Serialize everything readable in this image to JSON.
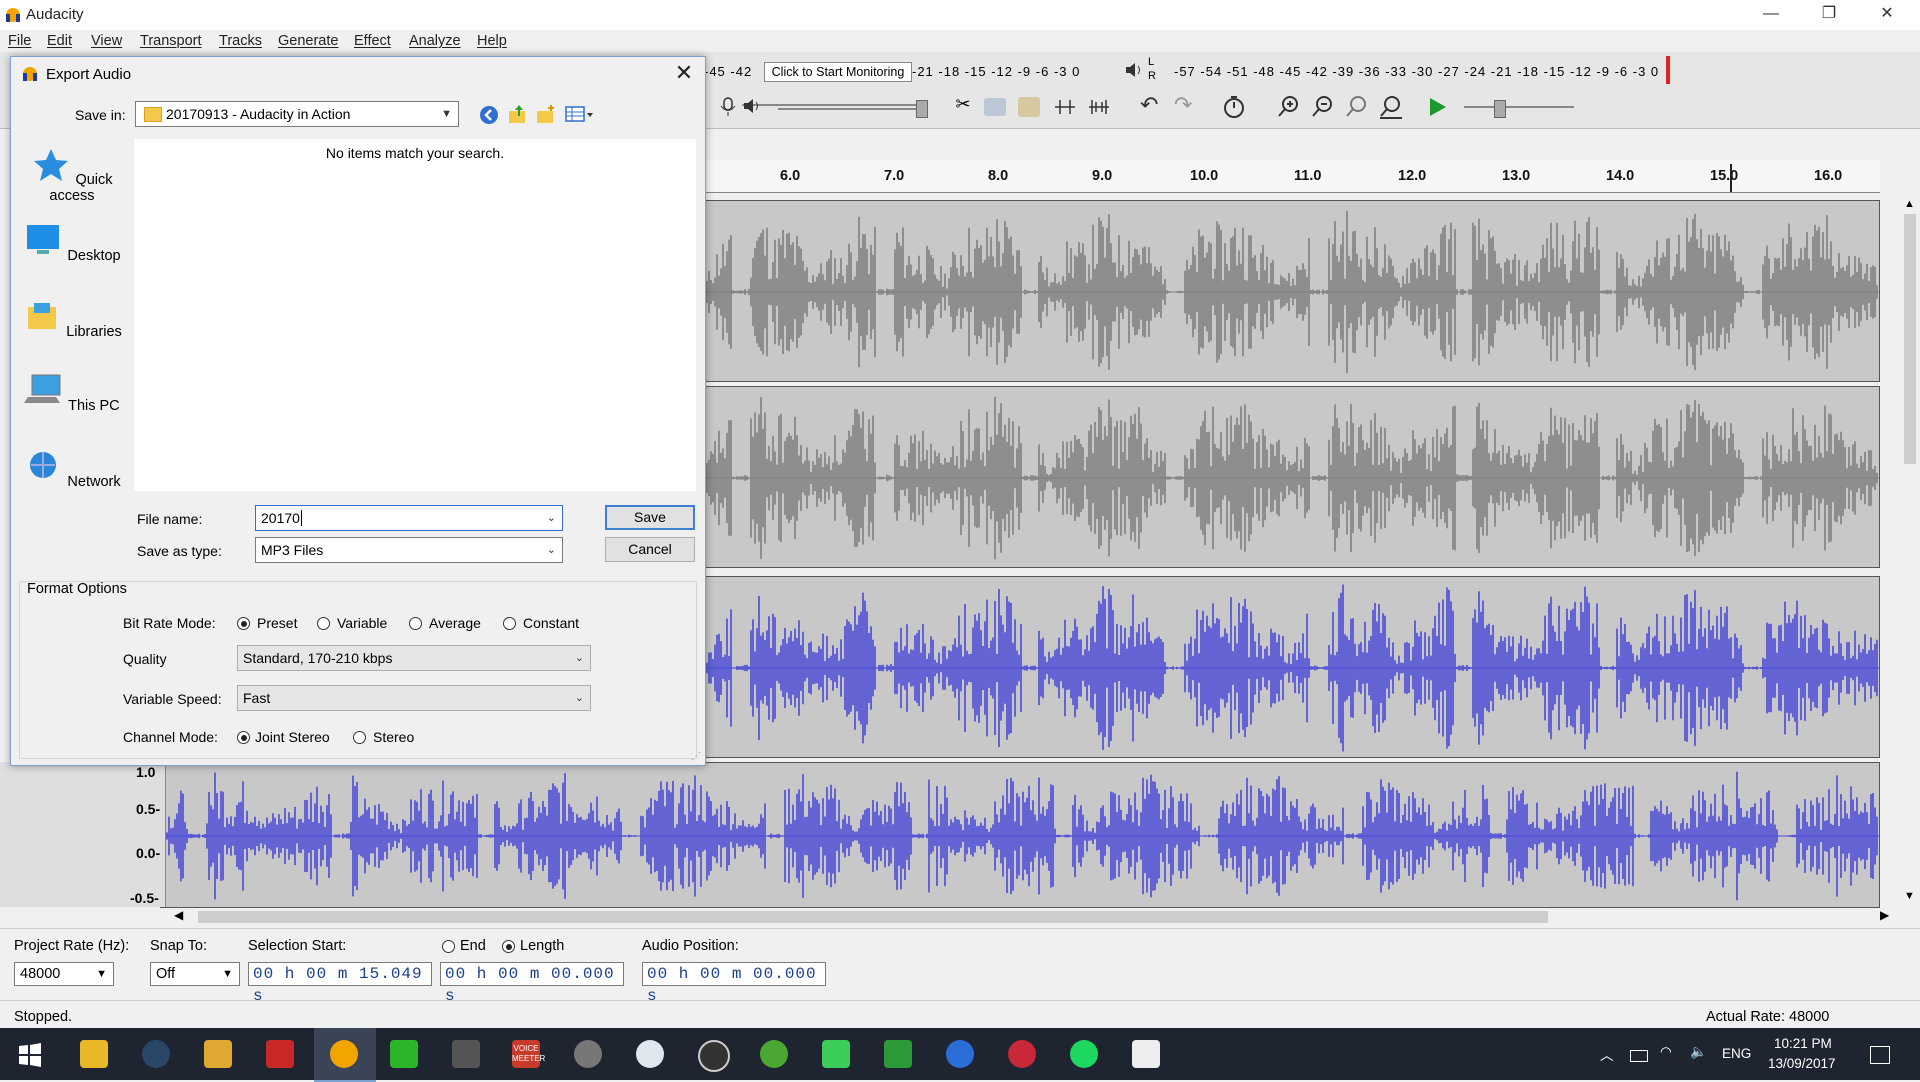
{
  "app": {
    "title": "Audacity",
    "menu": [
      "File",
      "Edit",
      "View",
      "Transport",
      "Tracks",
      "Generate",
      "Effect",
      "Analyze",
      "Help"
    ],
    "window_controls": [
      "—",
      "❐",
      "✕"
    ]
  },
  "meters": {
    "record_scale": "-45 -42",
    "record_scale_right": "-21 -18 -15 -12  -9  -6  -3  0",
    "monitor_tip": "Click to Start Monitoring",
    "play_scale": "-57 -54 -51 -48 -45 -42 -39 -36 -33 -30 -27 -24 -21 -18 -15 -12  -9  -6  -3  0",
    "lr": [
      "L",
      "R"
    ]
  },
  "ruler": {
    "ticks": [
      "6.0",
      "7.0",
      "8.0",
      "9.0",
      "10.0",
      "11.0",
      "12.0",
      "13.0",
      "14.0",
      "15.0",
      "16.0"
    ]
  },
  "amplitude_labels": [
    "1.0",
    "0.5-",
    "0.0-",
    "-0.5-"
  ],
  "selection_toolbar": {
    "project_rate_label": "Project Rate (Hz):",
    "project_rate_value": "48000",
    "snap_to_label": "Snap To:",
    "snap_to_value": "Off",
    "selection_start_label": "Selection Start:",
    "selection_start_value": "00 h 00 m 15.049 s",
    "end_label": "End",
    "length_label": "Length",
    "length_value": "00 h 00 m 00.000 s",
    "audio_position_label": "Audio Position:",
    "audio_position_value": "00 h 00 m 00.000 s"
  },
  "status": {
    "state": "Stopped.",
    "actual_rate": "Actual Rate: 48000"
  },
  "dialog": {
    "title": "Export Audio",
    "save_in_label": "Save in:",
    "save_in_value": "20170913 - Audacity in Action",
    "empty_message": "No items match your search.",
    "places": [
      "Quick access",
      "Desktop",
      "Libraries",
      "This PC",
      "Network"
    ],
    "file_name_label": "File name:",
    "file_name_value": "20170",
    "save_as_type_label": "Save as type:",
    "save_as_type_value": "MP3 Files",
    "save_button": "Save",
    "cancel_button": "Cancel",
    "format_options_title": "Format Options",
    "bit_rate_mode_label": "Bit Rate Mode:",
    "bit_rate_modes": [
      "Preset",
      "Variable",
      "Average",
      "Constant"
    ],
    "bit_rate_mode_selected": "Preset",
    "quality_label": "Quality",
    "quality_value": "Standard, 170-210 kbps",
    "variable_speed_label": "Variable Speed:",
    "variable_speed_value": "Fast",
    "channel_mode_label": "Channel Mode:",
    "channel_modes": [
      "Joint Stereo",
      "Stereo"
    ],
    "channel_mode_selected": "Joint Stereo"
  },
  "taskbar": {
    "time": "10:21 PM",
    "date": "13/09/2017",
    "language": "ENG",
    "voicemeeter_label": "VOICE\nMEETER"
  },
  "colors": {
    "waveform_grey": "#7f7f7f",
    "waveform_blue": "#4a4ad6",
    "taskbar": "#1f2530",
    "accent": "#3c7fd1"
  }
}
